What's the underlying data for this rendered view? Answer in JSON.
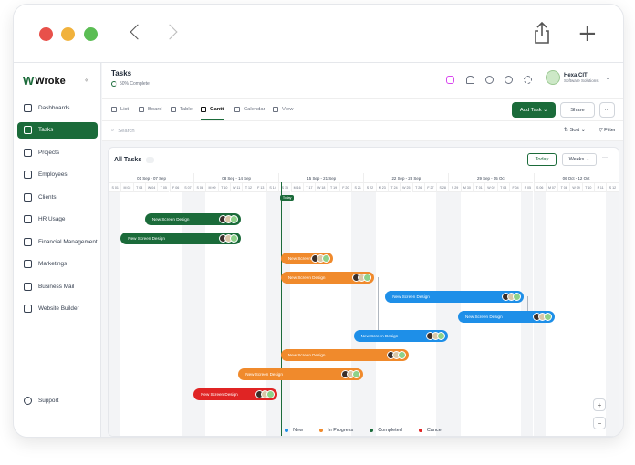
{
  "app": {
    "brand": "Wroke"
  },
  "sidebar": {
    "items": [
      {
        "label": "Dashboards",
        "icon": "home-icon"
      },
      {
        "label": "Tasks",
        "icon": "tasks-icon",
        "active": true
      },
      {
        "label": "Projects",
        "icon": "folder-icon"
      },
      {
        "label": "Employees",
        "icon": "users-icon"
      },
      {
        "label": "Clients",
        "icon": "clients-icon"
      },
      {
        "label": "HR Usage",
        "icon": "hr-icon"
      },
      {
        "label": "Financial Management",
        "icon": "money-icon"
      },
      {
        "label": "Marketings",
        "icon": "megaphone-icon"
      },
      {
        "label": "Business Mail",
        "icon": "mail-icon"
      },
      {
        "label": "Website Builder",
        "icon": "builder-icon"
      }
    ],
    "support": "Support"
  },
  "header": {
    "title": "Tasks",
    "subtitle": "50% Complete",
    "progress": 0.5,
    "user": {
      "name": "Hexa CIT",
      "role": "Software Solutions"
    }
  },
  "views": {
    "tabs": [
      "List",
      "Board",
      "Table",
      "Gantt",
      "Calendar",
      "View"
    ],
    "active": "Gantt",
    "add_task": "Add Task",
    "share": "Share",
    "more": "···"
  },
  "toolbar": {
    "search_placeholder": "Search",
    "sort": "Sort",
    "filter": "Filter"
  },
  "gantt": {
    "title": "All Tasks",
    "count": "··",
    "today_btn": "Today",
    "scale_btn": "Weeks",
    "more": "···",
    "today_label": "Today",
    "weeks": [
      "01 Sep - 07 Sep",
      "08 Sep - 14 Sep",
      "15 Sep - 21 Sep",
      "22 Sep - 28 Sep",
      "29 Sep - 05 Oct",
      "06 Oct - 12 Oct"
    ],
    "days": [
      "S 01",
      "M 02",
      "T 03",
      "W 04",
      "T 05",
      "F 06",
      "S 07",
      "S 08",
      "M 09",
      "T 10",
      "W 11",
      "T 12",
      "F 13",
      "S 14",
      "S 15",
      "M 16",
      "T 17",
      "W 18",
      "T 19",
      "F 20",
      "S 21",
      "S 22",
      "M 23",
      "T 24",
      "W 25",
      "T 26",
      "F 27",
      "S 28",
      "S 29",
      "M 30",
      "T 01",
      "W 02",
      "T 03",
      "F 04",
      "S 05",
      "S 06",
      "M 07",
      "T 08",
      "W 09",
      "T 10",
      "F 11",
      "S 12"
    ],
    "today_index": 14.2,
    "tasks": [
      {
        "name": "New Screen Design",
        "status": "Completed",
        "start": 3.0,
        "end": 10.9,
        "row": 0
      },
      {
        "name": "New Screen Design",
        "status": "Completed",
        "start": 1.0,
        "end": 10.9,
        "row": 1
      },
      {
        "name": "New Screen Design",
        "status": "In Progress",
        "start": 14.2,
        "end": 18.5,
        "row": 2
      },
      {
        "name": "New Screen Design",
        "status": "In Progress",
        "start": 14.2,
        "end": 21.9,
        "row": 3
      },
      {
        "name": "New Screen Design",
        "status": "New",
        "start": 22.8,
        "end": 34.2,
        "row": 4
      },
      {
        "name": "New Screen Design",
        "status": "New",
        "start": 28.8,
        "end": 36.8,
        "row": 5
      },
      {
        "name": "New Screen Design",
        "status": "New",
        "start": 20.2,
        "end": 28.0,
        "row": 6
      },
      {
        "name": "New Screen Design",
        "status": "In Progress",
        "start": 14.2,
        "end": 24.7,
        "row": 7
      },
      {
        "name": "New Screen Design",
        "status": "In Progress",
        "start": 10.7,
        "end": 21.0,
        "row": 8
      },
      {
        "name": "New Screen Design",
        "status": "Cancel",
        "start": 7.0,
        "end": 13.9,
        "row": 9
      }
    ]
  },
  "legend": [
    {
      "label": "New",
      "color": "#1e8fe8"
    },
    {
      "label": "In Progress",
      "color": "#f08a2c"
    },
    {
      "label": "Completed",
      "color": "#1b6b3a"
    },
    {
      "label": "Cancel",
      "color": "#e02424"
    }
  ],
  "status_colors": {
    "New": "#1e8fe8",
    "In Progress": "#f08a2c",
    "Completed": "#1b6b3a",
    "Cancel": "#e02424"
  }
}
